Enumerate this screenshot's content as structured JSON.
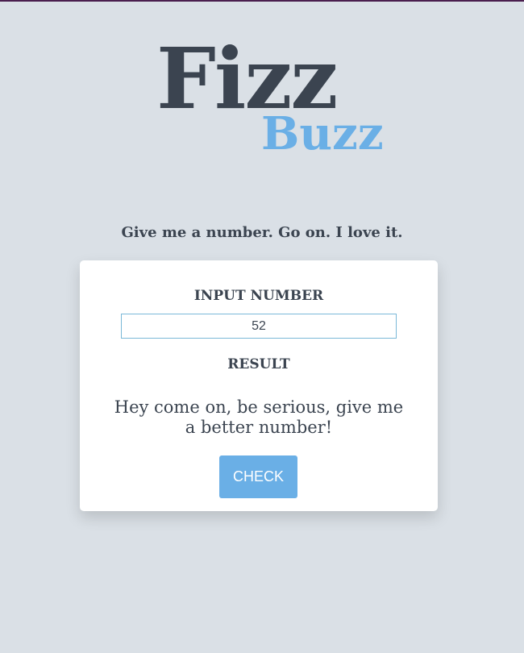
{
  "logo": {
    "fizz": "Fizz",
    "buzz": "Buzz"
  },
  "tagline": "Give me a number. Go on. I love it.",
  "card": {
    "input_label": "INPUT NUMBER",
    "input_value": "52",
    "result_label": "RESULT",
    "result_text": "Hey come on, be serious, give me a better number!",
    "check_label": "CHECK"
  },
  "colors": {
    "background": "#dae0e6",
    "text": "#3b4450",
    "accent": "#6aafe6",
    "card": "#ffffff"
  }
}
